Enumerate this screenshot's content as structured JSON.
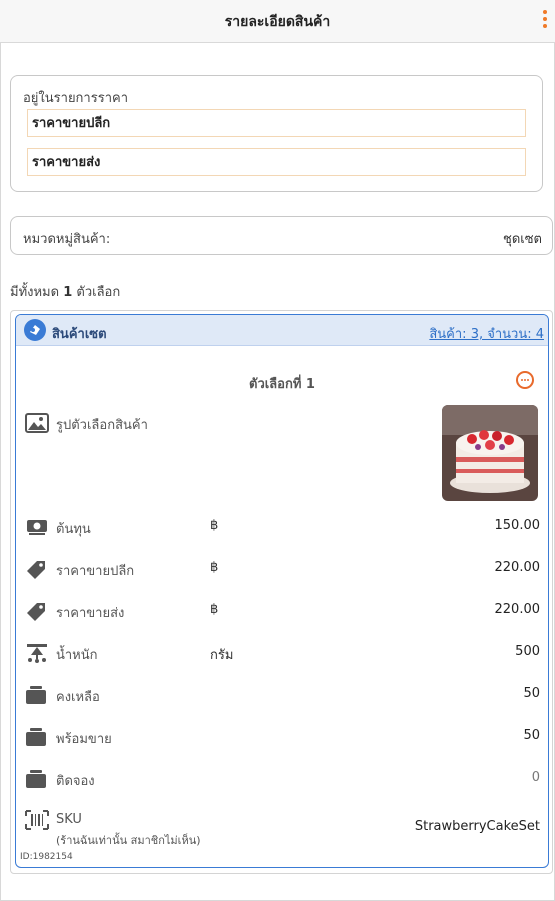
{
  "header": {
    "title": "รายละเอียดสินค้า",
    "more_icon": "kebab-menu-icon",
    "accent": "#f07a28"
  },
  "price_list": {
    "label": "อยู่ในรายการราคา",
    "items": [
      "ราคาขายปลีก",
      "ราคาขายส่ง"
    ]
  },
  "category": {
    "label": "หมวดหมู่สินค้า:",
    "value": "ชุดเซต"
  },
  "variants_count": {
    "prefix": "มีทั้งหมด",
    "count": "1",
    "suffix": "ตัวเลือก"
  },
  "variant": {
    "type_label": "สินค้าเซต",
    "link": "สินค้า: 3, จำนวน: 4",
    "option_title": "ตัวเลือกที่ 1",
    "image_label": "รูปตัวเลือกสินค้า",
    "rows": [
      {
        "icon": "cost-money-icon",
        "label": "ต้นทุน",
        "unit": "฿",
        "value": "150.00"
      },
      {
        "icon": "price-tag-icon",
        "label": "ราคาขายปลีก",
        "unit": "฿",
        "value": "220.00"
      },
      {
        "icon": "price-tag-icon",
        "label": "ราคาขายส่ง",
        "unit": "฿",
        "value": "220.00"
      },
      {
        "icon": "scale-weight-icon",
        "label": "น้ำหนัก",
        "unit": "กรัม",
        "value": "500"
      },
      {
        "icon": "stock-box-icon",
        "label": "คงเหลือ",
        "unit": "",
        "value": "50"
      },
      {
        "icon": "stock-box-icon",
        "label": "พร้อมขาย",
        "unit": "",
        "value": "50"
      },
      {
        "icon": "stock-box-icon",
        "label": "ติดจอง",
        "unit": "",
        "value": "0"
      }
    ],
    "sku": {
      "label": "SKU",
      "note": "(ร้านฉันเท่านั้น สมาชิกไม่เห็น)",
      "value": "StrawberryCakeSet"
    },
    "id_text": "ID:1982154"
  },
  "colors": {
    "blue": "#3a7bd5",
    "orange": "#e86a2c",
    "header_bg": "#dfe9f7"
  }
}
